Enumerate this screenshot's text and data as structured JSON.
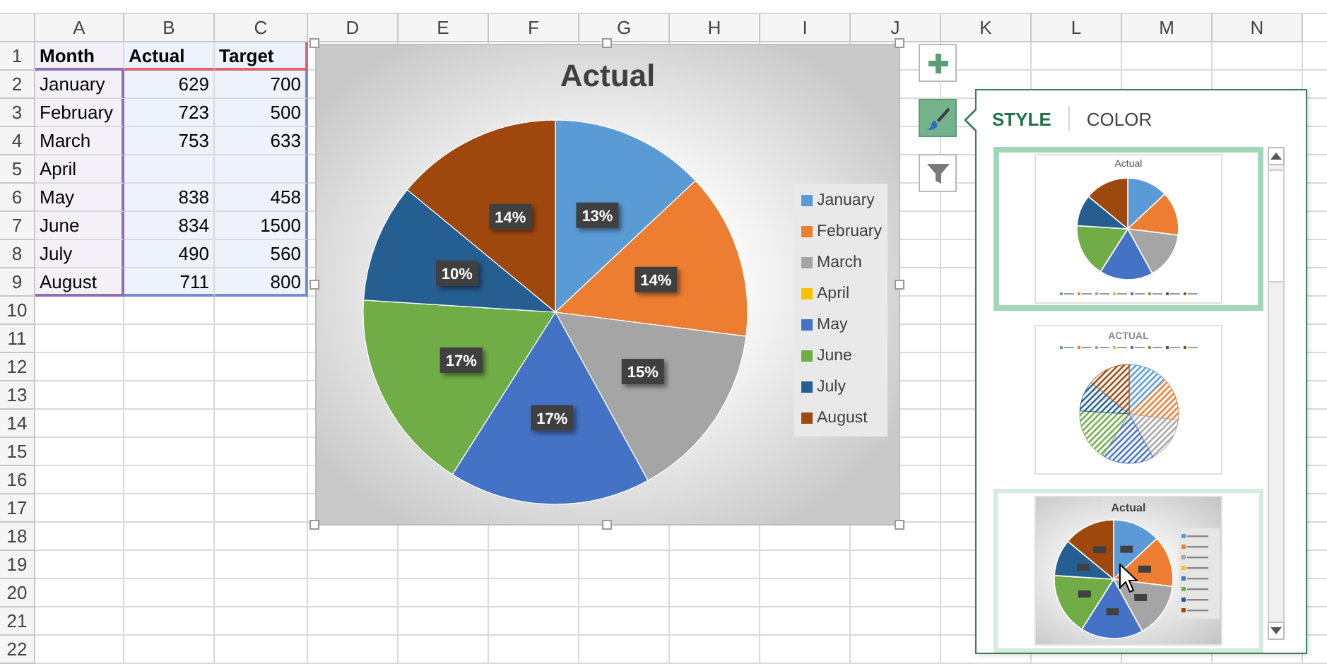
{
  "columns": [
    "A",
    "B",
    "C",
    "D",
    "E",
    "F",
    "G",
    "H",
    "I",
    "J",
    "K",
    "L",
    "M",
    "N"
  ],
  "rows": [
    {
      "number": "1",
      "cells": [
        {
          "kind": "header",
          "text": "Month"
        },
        {
          "kind": "header",
          "text": "Actual"
        },
        {
          "kind": "header",
          "text": "Target"
        }
      ]
    },
    {
      "number": "2",
      "cells": [
        {
          "kind": "label",
          "text": "January"
        },
        {
          "kind": "number",
          "text": "629"
        },
        {
          "kind": "number",
          "text": "700"
        }
      ]
    },
    {
      "number": "3",
      "cells": [
        {
          "kind": "label",
          "text": "February"
        },
        {
          "kind": "number",
          "text": "723"
        },
        {
          "kind": "number",
          "text": "500"
        }
      ]
    },
    {
      "number": "4",
      "cells": [
        {
          "kind": "label",
          "text": "March"
        },
        {
          "kind": "number",
          "text": "753"
        },
        {
          "kind": "number",
          "text": "633"
        }
      ]
    },
    {
      "number": "5",
      "cells": [
        {
          "kind": "label",
          "text": "April"
        }
      ]
    },
    {
      "number": "6",
      "cells": [
        {
          "kind": "label",
          "text": "May"
        },
        {
          "kind": "number",
          "text": "838"
        },
        {
          "kind": "number",
          "text": "458"
        }
      ]
    },
    {
      "number": "7",
      "cells": [
        {
          "kind": "label",
          "text": "June"
        },
        {
          "kind": "number",
          "text": "834"
        },
        {
          "kind": "number",
          "text": "1500"
        }
      ]
    },
    {
      "number": "8",
      "cells": [
        {
          "kind": "label",
          "text": "July"
        },
        {
          "kind": "number",
          "text": "490"
        },
        {
          "kind": "number",
          "text": "560"
        }
      ]
    },
    {
      "number": "9",
      "cells": [
        {
          "kind": "label",
          "text": "August"
        },
        {
          "kind": "number",
          "text": "711"
        },
        {
          "kind": "number",
          "text": "800"
        }
      ]
    },
    {
      "number": "10"
    },
    {
      "number": "11"
    },
    {
      "number": "12"
    },
    {
      "number": "13"
    },
    {
      "number": "14"
    },
    {
      "number": "15"
    },
    {
      "number": "16"
    },
    {
      "number": "17"
    },
    {
      "number": "18"
    },
    {
      "number": "19"
    },
    {
      "number": "20"
    },
    {
      "number": "21"
    },
    {
      "number": "22"
    }
  ],
  "chart": {
    "chart_data": {
      "type": "pie",
      "title": "Actual",
      "categories": [
        "January",
        "February",
        "March",
        "April",
        "May",
        "June",
        "July",
        "August"
      ],
      "values": [
        13,
        14,
        15,
        null,
        17,
        17,
        10,
        14
      ],
      "colors": [
        "#5b9bd5",
        "#ed7d31",
        "#a5a5a5",
        "#ffc000",
        "#4472c4",
        "#70ad47",
        "#255e91",
        "#9e480e"
      ],
      "value_labels": [
        "13%",
        "14%",
        "15%",
        null,
        "17%",
        "17%",
        "10%",
        "14%"
      ]
    }
  },
  "chart_buttons": [
    {
      "kind": "add",
      "selected": false
    },
    {
      "kind": "style",
      "selected": true
    },
    {
      "kind": "filter",
      "selected": false
    }
  ],
  "style_panel": {
    "tabs": [
      {
        "label": "STYLE",
        "selected": true
      },
      {
        "label": "COLOR",
        "selected": false
      }
    ],
    "styles": [
      {
        "kind": "plain",
        "title": "Actual",
        "selected": true,
        "hovered": false
      },
      {
        "kind": "hatched",
        "title": "ACTUAL",
        "selected": false,
        "hovered": false
      },
      {
        "kind": "labeled",
        "title": "Actual",
        "selected": false,
        "hovered": true
      }
    ]
  }
}
